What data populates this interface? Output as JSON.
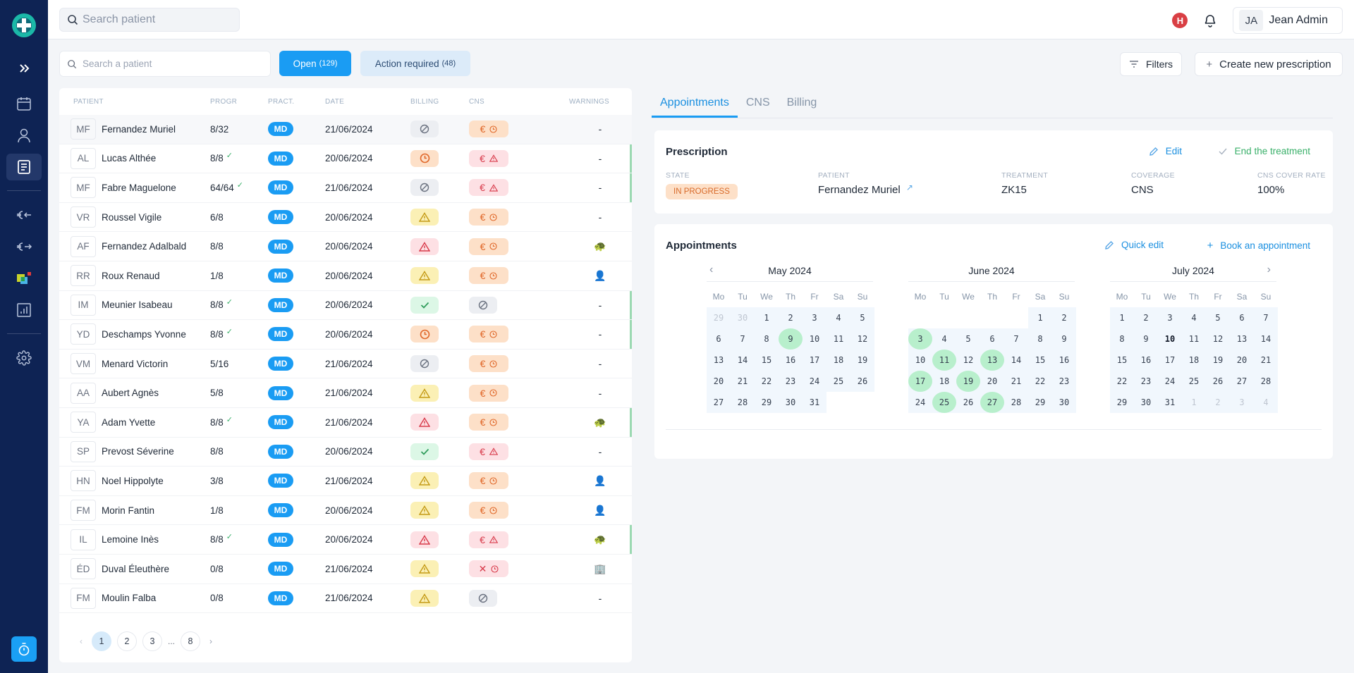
{
  "topbar": {
    "search_placeholder": "Search patient",
    "hospital_badge": "H",
    "user_initials": "JA",
    "user_name": "Jean Admin"
  },
  "sidebar": {
    "items": [
      {
        "name": "expand",
        "icon": "chevrons-right-icon"
      },
      {
        "name": "calendar",
        "icon": "calendar-icon"
      },
      {
        "name": "patients",
        "icon": "user-icon"
      },
      {
        "name": "prescriptions",
        "icon": "document-icon",
        "active": true
      },
      {
        "name": "billing-in",
        "icon": "euro-in-icon"
      },
      {
        "name": "billing-out",
        "icon": "euro-out-icon"
      },
      {
        "name": "cns",
        "icon": "cns-logo-icon"
      },
      {
        "name": "stats",
        "icon": "chart-icon"
      },
      {
        "name": "settings",
        "icon": "gear-icon"
      }
    ],
    "timer_icon": "stopwatch-icon"
  },
  "toolbar": {
    "search_placeholder": "Search a patient",
    "open_label": "Open",
    "open_count": "(129)",
    "action_label": "Action required",
    "action_count": "(48)",
    "filters_label": "Filters",
    "create_label": "Create new prescription"
  },
  "table": {
    "headers": [
      "PATIENT",
      "PROGR",
      "PRACT.",
      "DATE",
      "BILLING",
      "CNS",
      "WARNINGS"
    ],
    "rows": [
      {
        "initials": "MF",
        "name": "Fernandez Muriel",
        "progress": "8/32",
        "done": false,
        "pract": "MD",
        "date": "21/06/2024",
        "billing": "blocked",
        "cns": "euro-pending",
        "warning": "-",
        "selected": true,
        "bar": false
      },
      {
        "initials": "AL",
        "name": "Lucas Althée",
        "progress": "8/8",
        "done": true,
        "pract": "MD",
        "date": "20/06/2024",
        "billing": "pending",
        "cns": "euro-alert",
        "warning": "-",
        "bar": true
      },
      {
        "initials": "MF",
        "name": "Fabre Maguelone",
        "progress": "64/64",
        "done": true,
        "pract": "MD",
        "date": "21/06/2024",
        "billing": "blocked",
        "cns": "euro-alert",
        "warning": "-",
        "bar": true
      },
      {
        "initials": "VR",
        "name": "Roussel Vigile",
        "progress": "6/8",
        "done": false,
        "pract": "MD",
        "date": "20/06/2024",
        "billing": "warning",
        "cns": "euro-pending",
        "warning": "-",
        "bar": false
      },
      {
        "initials": "AF",
        "name": "Fernandez Adalbald",
        "progress": "8/8",
        "done": false,
        "pract": "MD",
        "date": "20/06/2024",
        "billing": "error",
        "cns": "euro-pending",
        "warning": "turtle",
        "bar": false
      },
      {
        "initials": "RR",
        "name": "Roux Renaud",
        "progress": "1/8",
        "done": false,
        "pract": "MD",
        "date": "20/06/2024",
        "billing": "warning",
        "cns": "euro-pending",
        "warning": "person",
        "bar": false
      },
      {
        "initials": "IM",
        "name": "Meunier Isabeau",
        "progress": "8/8",
        "done": true,
        "pract": "MD",
        "date": "20/06/2024",
        "billing": "ok",
        "cns": "blocked",
        "warning": "-",
        "bar": true
      },
      {
        "initials": "YD",
        "name": "Deschamps Yvonne",
        "progress": "8/8",
        "done": true,
        "pract": "MD",
        "date": "20/06/2024",
        "billing": "pending",
        "cns": "euro-pending",
        "warning": "-",
        "bar": true
      },
      {
        "initials": "VM",
        "name": "Menard Victorin",
        "progress": "5/16",
        "done": false,
        "pract": "MD",
        "date": "21/06/2024",
        "billing": "blocked",
        "cns": "euro-pending",
        "warning": "-",
        "bar": false
      },
      {
        "initials": "AA",
        "name": "Aubert Agnès",
        "progress": "5/8",
        "done": false,
        "pract": "MD",
        "date": "21/06/2024",
        "billing": "warning",
        "cns": "euro-pending",
        "warning": "-",
        "bar": false
      },
      {
        "initials": "YA",
        "name": "Adam Yvette",
        "progress": "8/8",
        "done": true,
        "pract": "MD",
        "date": "21/06/2024",
        "billing": "error",
        "cns": "euro-pending",
        "warning": "turtle",
        "bar": true
      },
      {
        "initials": "SP",
        "name": "Prevost Séverine",
        "progress": "8/8",
        "done": false,
        "pract": "MD",
        "date": "20/06/2024",
        "billing": "ok",
        "cns": "euro-alert",
        "warning": "-",
        "bar": false
      },
      {
        "initials": "HN",
        "name": "Noel Hippolyte",
        "progress": "3/8",
        "done": false,
        "pract": "MD",
        "date": "21/06/2024",
        "billing": "warning",
        "cns": "euro-pending",
        "warning": "person",
        "bar": false
      },
      {
        "initials": "FM",
        "name": "Morin Fantin",
        "progress": "1/8",
        "done": false,
        "pract": "MD",
        "date": "20/06/2024",
        "billing": "warning",
        "cns": "euro-pending",
        "warning": "person",
        "bar": false
      },
      {
        "initials": "IL",
        "name": "Lemoine Inès",
        "progress": "8/8",
        "done": true,
        "pract": "MD",
        "date": "20/06/2024",
        "billing": "error",
        "cns": "euro-alert",
        "warning": "turtle",
        "bar": true
      },
      {
        "initials": "ÉD",
        "name": "Duval Éleuthère",
        "progress": "0/8",
        "done": false,
        "pract": "MD",
        "date": "21/06/2024",
        "billing": "warning",
        "cns": "cross-pending",
        "warning": "building",
        "bar": false
      },
      {
        "initials": "FM",
        "name": "Moulin Falba",
        "progress": "0/8",
        "done": false,
        "pract": "MD",
        "date": "21/06/2024",
        "billing": "warning",
        "cns": "blocked",
        "warning": "-",
        "bar": false
      }
    ],
    "pagination": {
      "pages": [
        "1",
        "2",
        "3",
        "...",
        "8"
      ],
      "current": "1"
    }
  },
  "detail": {
    "tabs": [
      "Appointments",
      "CNS",
      "Billing"
    ],
    "active_tab": "Appointments",
    "prescription": {
      "title": "Prescription",
      "edit_label": "Edit",
      "end_label": "End the treatment",
      "fields": [
        {
          "label": "STATE",
          "value": "IN PROGRESS",
          "type": "badge"
        },
        {
          "label": "PATIENT",
          "value": "Fernandez Muriel",
          "type": "link"
        },
        {
          "label": "TREATMENT",
          "value": "ZK15"
        },
        {
          "label": "COVERAGE",
          "value": "CNS"
        },
        {
          "label": "CNS COVER RATE",
          "value": "100%"
        }
      ]
    },
    "appointments": {
      "title": "Appointments",
      "quick_edit_label": "Quick edit",
      "book_label": "Book an appointment",
      "weekdays": [
        "Mo",
        "Tu",
        "We",
        "Th",
        "Fr",
        "Sa",
        "Su"
      ],
      "months": [
        {
          "title": "May 2024",
          "lead": [
            29,
            30
          ],
          "days": 31,
          "trail": [],
          "start": 2,
          "highlight": [
            9
          ],
          "bold": []
        },
        {
          "title": "June 2024",
          "lead": [],
          "days": 30,
          "trail": [],
          "start": 5,
          "highlight": [
            3,
            11,
            13,
            17,
            19,
            25,
            27
          ],
          "bold": []
        },
        {
          "title": "July 2024",
          "lead": [],
          "days": 31,
          "trail": [
            1,
            2,
            3,
            4
          ],
          "start": 0,
          "highlight": [],
          "bold": [
            10
          ]
        }
      ]
    }
  },
  "colors": {
    "accent": "#1a9cf3",
    "sidebar": "#0e2354",
    "success": "#3ab06a",
    "appointment_highlight": "#b8efcc"
  }
}
